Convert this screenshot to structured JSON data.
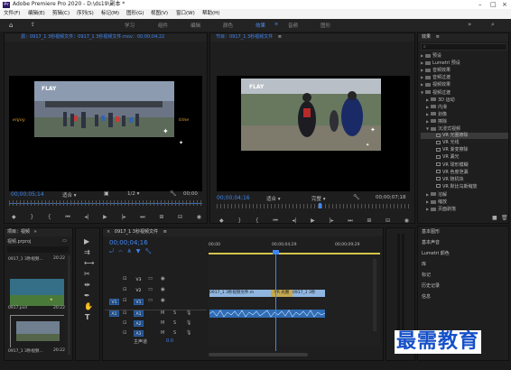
{
  "app": {
    "title": "Adobe Premiere Pro 2020 - D:\\ds19\\副本 *",
    "logo": "Pr"
  },
  "menu": [
    "文件(F)",
    "编辑(E)",
    "剪辑(C)",
    "序列(S)",
    "标记(M)",
    "图形(G)",
    "视图(V)",
    "窗口(W)",
    "帮助(H)"
  ],
  "workspaces": {
    "items": [
      "学习",
      "组件",
      "编辑",
      "颜色",
      "效果",
      "音频",
      "图形"
    ],
    "active": "效果"
  },
  "source_monitor": {
    "tab": "源：0917_1 3秒视频文件：0917_1 3秒视频文件.mov：00;00;04;22",
    "timecode": "00;00;05;14",
    "fit": "适合",
    "resolution": "1/2",
    "end_timecode": "00;00",
    "video": {
      "caption": "FLAY",
      "left_text": "enjoy",
      "right_text": "time"
    }
  },
  "program_monitor": {
    "tab": "节目：0917_1 3秒视频文件",
    "timecode": "00;00;04;16",
    "fit": "适合",
    "quality": "完整",
    "end_timecode": "00;00;07;18",
    "video": {
      "caption": "FLAY"
    }
  },
  "effects_panel": {
    "tab": "效果",
    "items": [
      {
        "label": "预设",
        "level": 0,
        "kind": "folder"
      },
      {
        "label": "Lumetri 预设",
        "level": 0,
        "kind": "folder"
      },
      {
        "label": "音频效果",
        "level": 0,
        "kind": "folder"
      },
      {
        "label": "音频过渡",
        "level": 0,
        "kind": "folder"
      },
      {
        "label": "视频效果",
        "level": 0,
        "kind": "folder"
      },
      {
        "label": "视频过渡",
        "level": 0,
        "kind": "folder",
        "open": true
      },
      {
        "label": "3D 运动",
        "level": 1,
        "kind": "folder"
      },
      {
        "label": "内滑",
        "level": 1,
        "kind": "folder"
      },
      {
        "label": "划像",
        "level": 1,
        "kind": "folder"
      },
      {
        "label": "擦除",
        "level": 1,
        "kind": "folder"
      },
      {
        "label": "沉浸式视频",
        "level": 1,
        "kind": "folder",
        "open": true
      },
      {
        "label": "VR 光圈擦除",
        "level": 2,
        "kind": "effect",
        "selected": true
      },
      {
        "label": "VR 光线",
        "level": 2,
        "kind": "effect"
      },
      {
        "label": "VR 渐变擦除",
        "level": 2,
        "kind": "effect"
      },
      {
        "label": "VR 漏光",
        "level": 2,
        "kind": "effect"
      },
      {
        "label": "VR 球形模糊",
        "level": 2,
        "kind": "effect"
      },
      {
        "label": "VR 色度泄漏",
        "level": 2,
        "kind": "effect"
      },
      {
        "label": "VR 随机块",
        "level": 2,
        "kind": "effect"
      },
      {
        "label": "VR 默比乌斯缩放",
        "level": 2,
        "kind": "effect"
      },
      {
        "label": "溶解",
        "level": 1,
        "kind": "folder"
      },
      {
        "label": "缩放",
        "level": 1,
        "kind": "folder"
      },
      {
        "label": "页面剥落",
        "level": 1,
        "kind": "folder"
      }
    ]
  },
  "side_panels": [
    "基本图形",
    "基本声音",
    "Lumetri 颜色",
    "库",
    "标记",
    "历史记录",
    "信息"
  ],
  "project_panel": {
    "tab": "项目：视频",
    "file": "视频.prproj",
    "items": [
      {
        "name": "0917_1 3秒视频...",
        "duration": "20:22"
      },
      {
        "name": "0917.psd",
        "duration": "20:22"
      },
      {
        "name": "0917_1 3秒视频...",
        "duration": "20:22"
      }
    ]
  },
  "timeline": {
    "tab": "0917_1 3秒视频文件",
    "timecode": "00;00;04;16",
    "ruler": [
      "00;00",
      "00;00;04;29",
      "00;00;09;29"
    ],
    "video_tracks": [
      "V3",
      "V2",
      "V1"
    ],
    "audio_tracks": [
      "A1",
      "A2",
      "A3"
    ],
    "master_label": "主声道",
    "master_value": "0.0",
    "clips": {
      "v1_a": "0917_1 3秒视频文件.m",
      "v1_b": "0917_1 3秒",
      "transition": "VR 光圈"
    }
  },
  "watermark": "最需教育"
}
